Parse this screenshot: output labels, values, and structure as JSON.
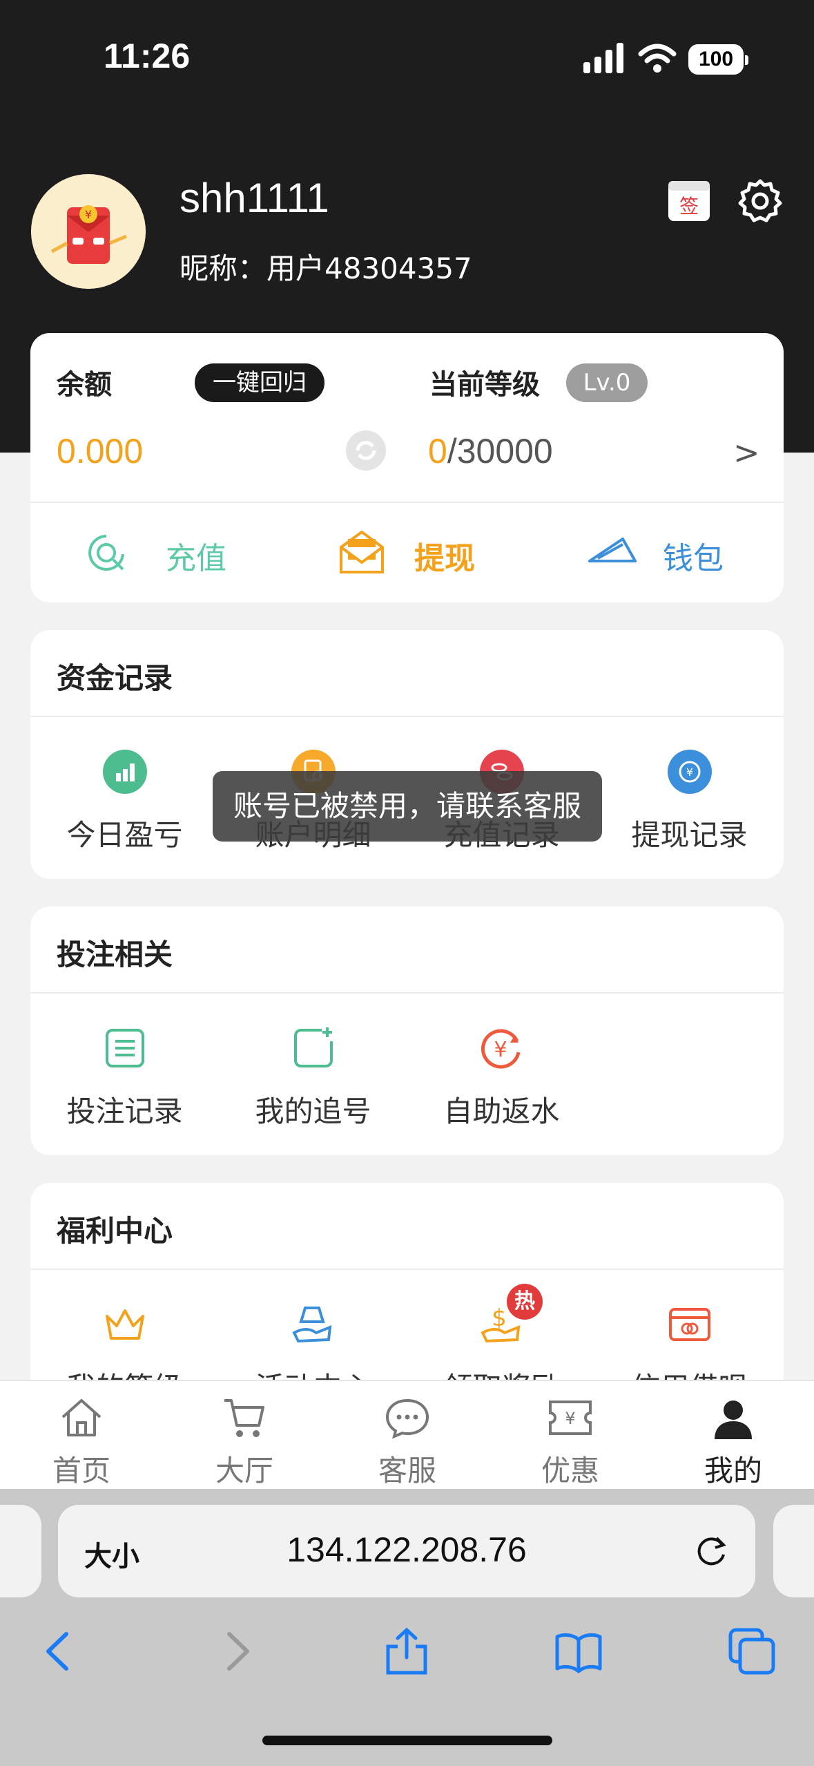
{
  "status_bar": {
    "time": "11:26",
    "battery": "100"
  },
  "profile": {
    "username": "shh1111",
    "nickname": "昵称：用户48304357",
    "sign_icon_text": "签"
  },
  "balance_card": {
    "balance_label": "余额",
    "recall_button": "一键回归",
    "balance_value": "0.000",
    "level_label": "当前等级",
    "level_badge": "Lv.0",
    "level_progress_current": "0",
    "level_progress_total": "/30000",
    "arrow": ">",
    "actions": {
      "recharge": "充值",
      "withdraw": "提现",
      "wallet": "钱包"
    }
  },
  "funds_section": {
    "title": "资金记录",
    "items": [
      {
        "label": "今日盈亏"
      },
      {
        "label": "账户明细"
      },
      {
        "label": "充值记录"
      },
      {
        "label": "提现记录"
      }
    ]
  },
  "bet_section": {
    "title": "投注相关",
    "items": [
      {
        "label": "投注记录"
      },
      {
        "label": "我的追号"
      },
      {
        "label": "自助返水"
      }
    ]
  },
  "welfare_section": {
    "title": "福利中心",
    "hot_badge": "热",
    "items": [
      {
        "label": "我的等级"
      },
      {
        "label": "活动中心"
      },
      {
        "label": "领取奖励"
      },
      {
        "label": "信用借呗"
      }
    ]
  },
  "toast": "账号已被禁用，请联系客服",
  "tabbar": {
    "items": [
      {
        "label": "首页"
      },
      {
        "label": "大厅"
      },
      {
        "label": "客服"
      },
      {
        "label": "优惠"
      },
      {
        "label": "我的"
      }
    ]
  },
  "browser": {
    "text_size": "大小",
    "url": "134.122.208.76"
  },
  "colors": {
    "accent": "#f4a21b",
    "recharge": "#5cc9a7",
    "withdraw": "#f4a21b",
    "wallet": "#3b8fdb",
    "dark_header": "#1d1d1d"
  }
}
